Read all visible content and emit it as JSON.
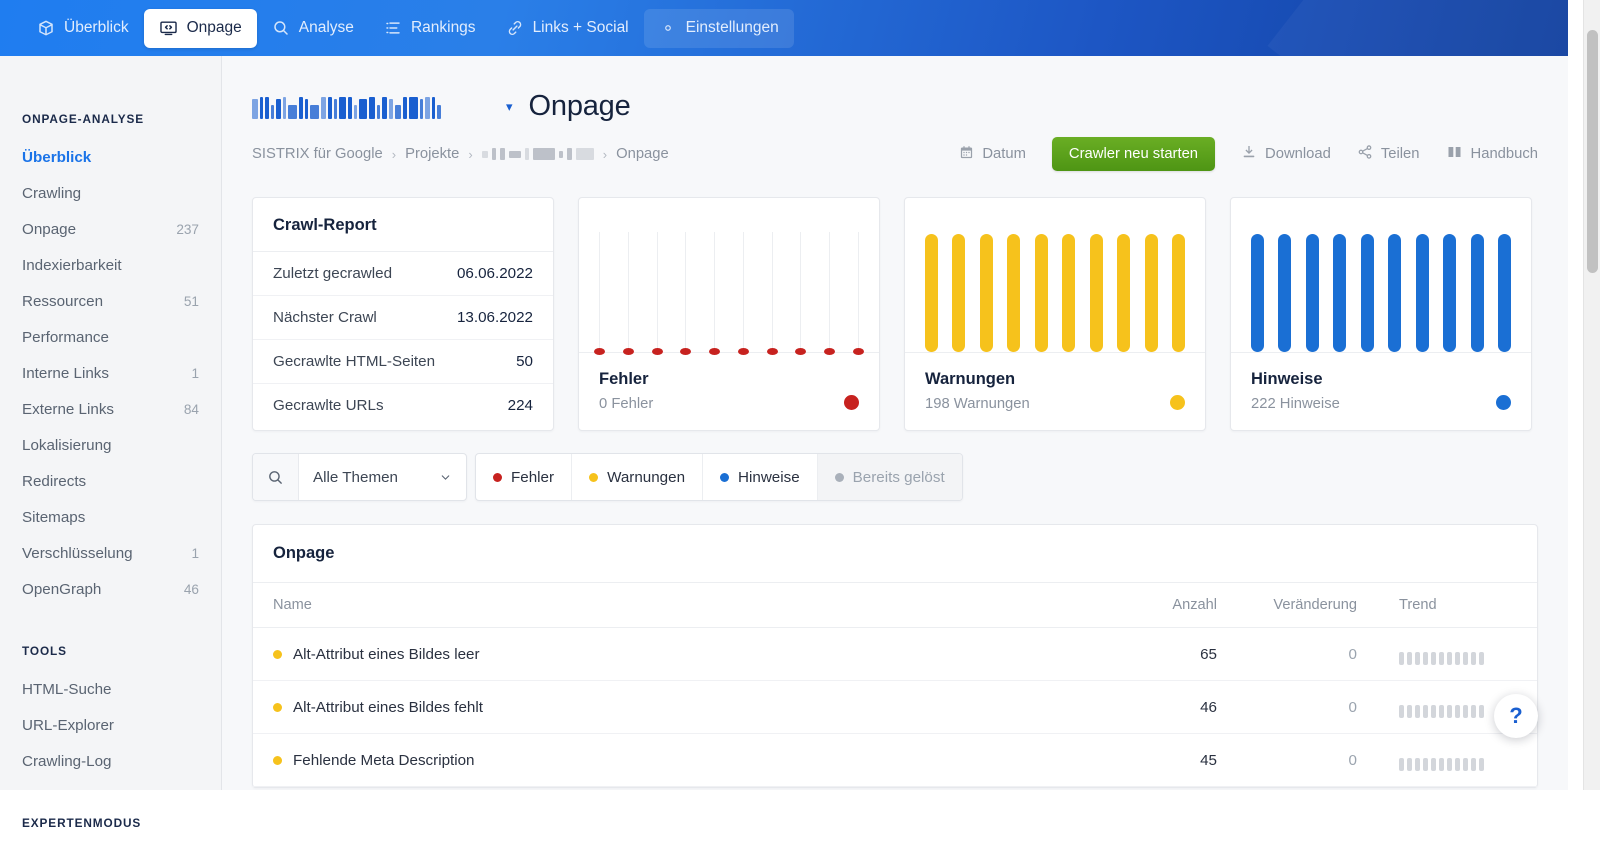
{
  "topnav": {
    "items": [
      {
        "label": "Überblick",
        "icon": "cube-icon",
        "state": "normal"
      },
      {
        "label": "Onpage",
        "icon": "monitor-code-icon",
        "state": "active"
      },
      {
        "label": "Analyse",
        "icon": "search-icon",
        "state": "normal"
      },
      {
        "label": "Rankings",
        "icon": "list-icon",
        "state": "normal"
      },
      {
        "label": "Links + Social",
        "icon": "link-icon",
        "state": "normal"
      },
      {
        "label": "Einstellungen",
        "icon": "gear-icon",
        "state": "tinted"
      }
    ]
  },
  "sidebar": {
    "sections": [
      {
        "heading": "ONPAGE-ANALYSE",
        "items": [
          {
            "label": "Überblick",
            "count": "",
            "active": true
          },
          {
            "label": "Crawling",
            "count": "",
            "active": false
          },
          {
            "label": "Onpage",
            "count": "237",
            "active": false
          },
          {
            "label": "Indexierbarkeit",
            "count": "",
            "active": false
          },
          {
            "label": "Ressourcen",
            "count": "51",
            "active": false
          },
          {
            "label": "Performance",
            "count": "",
            "active": false
          },
          {
            "label": "Interne Links",
            "count": "1",
            "active": false
          },
          {
            "label": "Externe Links",
            "count": "84",
            "active": false
          },
          {
            "label": "Lokalisierung",
            "count": "",
            "active": false
          },
          {
            "label": "Redirects",
            "count": "",
            "active": false
          },
          {
            "label": "Sitemaps",
            "count": "",
            "active": false
          },
          {
            "label": "Verschlüsselung",
            "count": "1",
            "active": false
          },
          {
            "label": "OpenGraph",
            "count": "46",
            "active": false
          }
        ]
      },
      {
        "heading": "TOOLS",
        "items": [
          {
            "label": "HTML-Suche",
            "count": "",
            "active": false
          },
          {
            "label": "URL-Explorer",
            "count": "",
            "active": false
          },
          {
            "label": "Crawling-Log",
            "count": "",
            "active": false
          }
        ]
      },
      {
        "heading": "EXPERTENMODUS",
        "items": []
      }
    ]
  },
  "header": {
    "project_name_redacted": true,
    "page_title": "Onpage",
    "breadcrumb": {
      "first": "SISTRIX für Google",
      "second": "Projekte",
      "redacted": true,
      "last": "Onpage"
    },
    "actions": {
      "date_label": "Datum",
      "crawl_button": "Crawler neu starten",
      "download_label": "Download",
      "share_label": "Teilen",
      "manual_label": "Handbuch"
    }
  },
  "crawl_report": {
    "title": "Crawl-Report",
    "rows": [
      {
        "label": "Zuletzt gecrawled",
        "value": "06.06.2022"
      },
      {
        "label": "Nächster Crawl",
        "value": "13.06.2022"
      },
      {
        "label": "Gecrawlte HTML-Seiten",
        "value": "50"
      },
      {
        "label": "Gecrawlte URLs",
        "value": "224"
      }
    ]
  },
  "metric_cards": [
    {
      "name": "Fehler",
      "sub": "0 Fehler",
      "color": "#c7221f",
      "style": "zero-dots"
    },
    {
      "name": "Warnungen",
      "sub": "198 Warnungen",
      "color": "#f6c21c",
      "style": "bars"
    },
    {
      "name": "Hinweise",
      "sub": "222 Hinweise",
      "color": "#1a6fd4",
      "style": "bars"
    }
  ],
  "chart_data": [
    {
      "type": "bar",
      "title": "Fehler",
      "categories": [
        "1",
        "2",
        "3",
        "4",
        "5",
        "6",
        "7",
        "8",
        "9",
        "10"
      ],
      "values": [
        0,
        0,
        0,
        0,
        0,
        0,
        0,
        0,
        0,
        0
      ],
      "ylim": [
        0,
        120
      ],
      "color": "#c7221f",
      "xlabel": "",
      "ylabel": "",
      "grid": false,
      "legend": "none"
    },
    {
      "type": "bar",
      "title": "Warnungen",
      "categories": [
        "1",
        "2",
        "3",
        "4",
        "5",
        "6",
        "7",
        "8",
        "9",
        "10"
      ],
      "values": [
        118,
        118,
        118,
        118,
        118,
        118,
        118,
        118,
        118,
        118
      ],
      "ylim": [
        0,
        120
      ],
      "color": "#f6c21c",
      "xlabel": "",
      "ylabel": "",
      "grid": false,
      "legend": "none"
    },
    {
      "type": "bar",
      "title": "Hinweise",
      "categories": [
        "1",
        "2",
        "3",
        "4",
        "5",
        "6",
        "7",
        "8",
        "9",
        "10"
      ],
      "values": [
        118,
        118,
        118,
        118,
        118,
        118,
        118,
        118,
        118,
        118
      ],
      "ylim": [
        0,
        120
      ],
      "color": "#1a6fd4",
      "xlabel": "",
      "ylabel": "",
      "grid": false,
      "legend": "none"
    }
  ],
  "filterbar": {
    "search_placeholder": "",
    "topic_select": "Alle Themen",
    "chips": [
      {
        "label": "Fehler",
        "color": "#c7221f",
        "disabled": false
      },
      {
        "label": "Warnungen",
        "color": "#f6c21c",
        "disabled": false
      },
      {
        "label": "Hinweise",
        "color": "#1a6fd4",
        "disabled": false
      },
      {
        "label": "Bereits gelöst",
        "color": "#a9b0ba",
        "disabled": true
      }
    ]
  },
  "table": {
    "title": "Onpage",
    "headers": {
      "name": "Name",
      "anzahl": "Anzahl",
      "veraenderung": "Veränderung",
      "trend": "Trend"
    },
    "rows": [
      {
        "dot": "#f6c21c",
        "name": "Alt-Attribut eines Bildes leer",
        "anzahl": "65",
        "veraenderung": "0",
        "trend": [
          13,
          13,
          13,
          13,
          13,
          13,
          13,
          13,
          13,
          13,
          13
        ]
      },
      {
        "dot": "#f6c21c",
        "name": "Alt-Attribut eines Bildes fehlt",
        "anzahl": "46",
        "veraenderung": "0",
        "trend": [
          13,
          13,
          13,
          13,
          13,
          13,
          13,
          13,
          13,
          13,
          13
        ]
      },
      {
        "dot": "#f6c21c",
        "name": "Fehlende Meta Description",
        "anzahl": "45",
        "veraenderung": "0",
        "trend": [
          13,
          13,
          13,
          13,
          13,
          13,
          13,
          13,
          13,
          13,
          13
        ]
      }
    ]
  },
  "fab": {
    "label": "?"
  }
}
